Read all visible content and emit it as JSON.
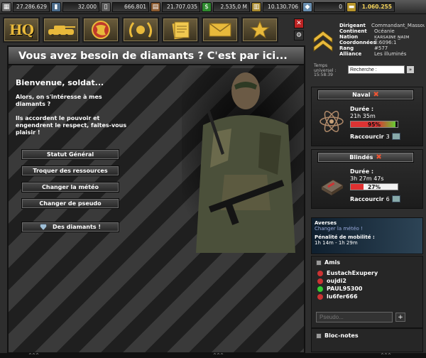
{
  "resources": [
    {
      "icon": "metal-icon",
      "glyph": "▦",
      "color": "#6c6c6c",
      "value": "27.286.629",
      "width": 52
    },
    {
      "icon": "crystal-icon",
      "glyph": "▮",
      "color": "#4a6b8a",
      "value": "32.000",
      "width": 52
    },
    {
      "icon": "fuel-icon",
      "glyph": "▯",
      "color": "#5c5c5c",
      "value": "666.801",
      "width": 52
    },
    {
      "icon": "bricks-icon",
      "glyph": "▤",
      "color": "#8a5a30",
      "value": "21.707.035",
      "width": 54
    },
    {
      "icon": "money-icon",
      "glyph": "$",
      "color": "#2f8a2f",
      "value": "2.535,0 M",
      "width": 52
    },
    {
      "icon": "food-icon",
      "glyph": "▥",
      "color": "#a88a30",
      "value": "10.130.706",
      "width": 54
    },
    {
      "icon": "diamond-icon",
      "glyph": "◆",
      "color": "#6a8fb0",
      "value": "0",
      "width": 44
    },
    {
      "icon": "gold-icon",
      "glyph": "▬",
      "color": "#b8962c",
      "value": "1.060.255",
      "width": 52,
      "gold": true
    }
  ],
  "nav": {
    "hq_label": "HQ",
    "close": "✕",
    "settings": "⚙"
  },
  "player": {
    "rows": [
      {
        "k": "Dirigeant",
        "v": "Commandant_Massoud"
      },
      {
        "k": "Continent",
        "v": "Océanie"
      },
      {
        "k": "Nation",
        "v": "ᴋ̲ᴀʀꜱᴀɪɴᴇ ɴ̲ᴀɪᴍ"
      },
      {
        "k": "Coordonnées",
        "v": "3:6096:1"
      },
      {
        "k": "Rang",
        "v": "#577"
      },
      {
        "k": "Alliance",
        "v": "Les illuminés"
      }
    ],
    "temps_label1": "Temps",
    "temps_label2": "universel :",
    "temps_value": "15:58:39",
    "search_placeholder": "Recherche :",
    "search_go": "»"
  },
  "main": {
    "title": "Vous avez besoin de diamants ? C'est par ici...",
    "welcome": "Bienvenue, soldat...",
    "intro1": "Alors, on s'intéresse à mes diamants ?",
    "intro2": "Ils accordent le pouvoir et engendrent le respect, faites-vous plaisir !",
    "buttons": {
      "status": "Statut Général",
      "trade": "Troquer des ressources",
      "weather": "Changer la météo",
      "pseudo": "Changer de pseudo",
      "diamonds": "Des diamants !"
    }
  },
  "queues": [
    {
      "title": "Naval",
      "duree_label": "Durée :",
      "time": "21h 35m",
      "progress": 95,
      "pct_label": "95%",
      "bar_color": "#e03030",
      "raccourcir_label": "Raccourcir",
      "raccourcir_count": "3"
    },
    {
      "title": "Blindés",
      "duree_label": "Durée :",
      "time": "3h 27m 47s",
      "progress": 27,
      "pct_label": "27%",
      "bar_color": "#e03030",
      "raccourcir_label": "Raccourcir",
      "raccourcir_count": "6"
    }
  ],
  "weather": {
    "title": "Averses",
    "link": "Changer la météo !",
    "penalty": "Pénalité de mobilité :",
    "penalty_value": "1h 14m - 1h 29m"
  },
  "friends": {
    "title": "Amis",
    "items": [
      {
        "name": "EustachExupery",
        "status": "red"
      },
      {
        "name": "oujdi2",
        "status": "red"
      },
      {
        "name": "PAUL95300",
        "status": "green"
      },
      {
        "name": "lu6fer666",
        "status": "red"
      }
    ],
    "pseudo_placeholder": "Pseudo...",
    "add": "+"
  },
  "bloc_notes": {
    "title": "Bloc-notes"
  },
  "footer": {
    "arrows": "^^^"
  }
}
